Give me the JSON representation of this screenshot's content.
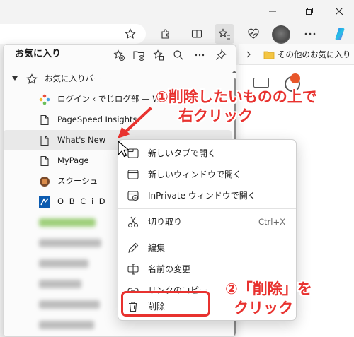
{
  "panel": {
    "title": "お気に入り",
    "items": [
      {
        "label": "お気に入りバー",
        "icon": "star-icon"
      },
      {
        "label": "ログイン ‹ でじログ部 — WordP",
        "icon": "wordpress-favicon"
      },
      {
        "label": "PageSpeed Insights",
        "icon": "page-icon"
      },
      {
        "label": "What's New",
        "icon": "page-icon"
      },
      {
        "label": "MyPage",
        "icon": "page-icon"
      },
      {
        "label": "スクーシュ",
        "icon": "round-favicon"
      },
      {
        "label": "O B C i D",
        "icon": "obcid-favicon"
      }
    ]
  },
  "favbar": {
    "other_favorites": "その他のお気に入り"
  },
  "menu": {
    "items": [
      {
        "label": "新しいタブで開く",
        "icon": "new-tab-icon"
      },
      {
        "label": "新しいウィンドウで開く",
        "icon": "new-window-icon"
      },
      {
        "label": "InPrivate ウィンドウで開く",
        "icon": "inprivate-icon"
      },
      {
        "label": "切り取り",
        "shortcut": "Ctrl+X",
        "icon": "scissors-icon"
      },
      {
        "label": "編集",
        "icon": "pencil-icon"
      },
      {
        "label": "名前の変更",
        "icon": "rename-icon"
      },
      {
        "label": "リンクのコピー",
        "icon": "link-icon"
      },
      {
        "label": "削除",
        "icon": "trash-icon"
      }
    ]
  },
  "annotations": {
    "step1_line1": "①削除したいものの上で",
    "step1_line2": "右クリック",
    "step2_line1": "②「削除」を",
    "step2_line2": "クリック"
  },
  "colors": {
    "annotation": "#e8322f",
    "accent": "#0067c0"
  }
}
